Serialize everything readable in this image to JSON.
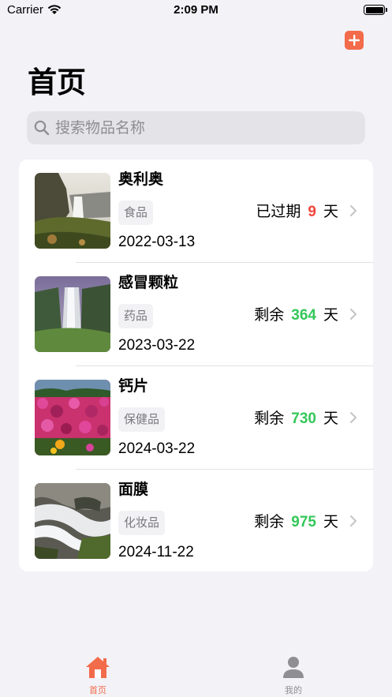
{
  "status_bar": {
    "carrier": "Carrier",
    "time": "2:09 PM"
  },
  "header": {
    "title": "首页",
    "add_icon": "plus-icon"
  },
  "search": {
    "placeholder": "搜索物品名称"
  },
  "items": [
    {
      "name": "奥利奥",
      "category": "食品",
      "status_prefix": "已过期",
      "days": "9",
      "unit": "天",
      "date": "2022-03-13",
      "days_color": "#f0463c",
      "thumb": "waterfall-cliff"
    },
    {
      "name": "感冒颗粒",
      "category": "药品",
      "status_prefix": "剩余",
      "days": "364",
      "unit": "天",
      "date": "2023-03-22",
      "days_color": "#34c759",
      "thumb": "waterfall-gorge"
    },
    {
      "name": "钙片",
      "category": "保健品",
      "status_prefix": "剩余",
      "days": "730",
      "unit": "天",
      "date": "2024-03-22",
      "days_color": "#34c759",
      "thumb": "flower-field"
    },
    {
      "name": "面膜",
      "category": "化妆品",
      "status_prefix": "剩余",
      "days": "975",
      "unit": "天",
      "date": "2024-11-22",
      "days_color": "#34c759",
      "thumb": "river-rocks"
    }
  ],
  "tabs": [
    {
      "label": "首页",
      "icon": "home-icon",
      "active": true
    },
    {
      "label": "我的",
      "icon": "person-icon",
      "active": false
    }
  ],
  "colors": {
    "accent": "#f26b4a",
    "inactive": "#8e8e93",
    "expired": "#f0463c",
    "remaining": "#34c759"
  }
}
